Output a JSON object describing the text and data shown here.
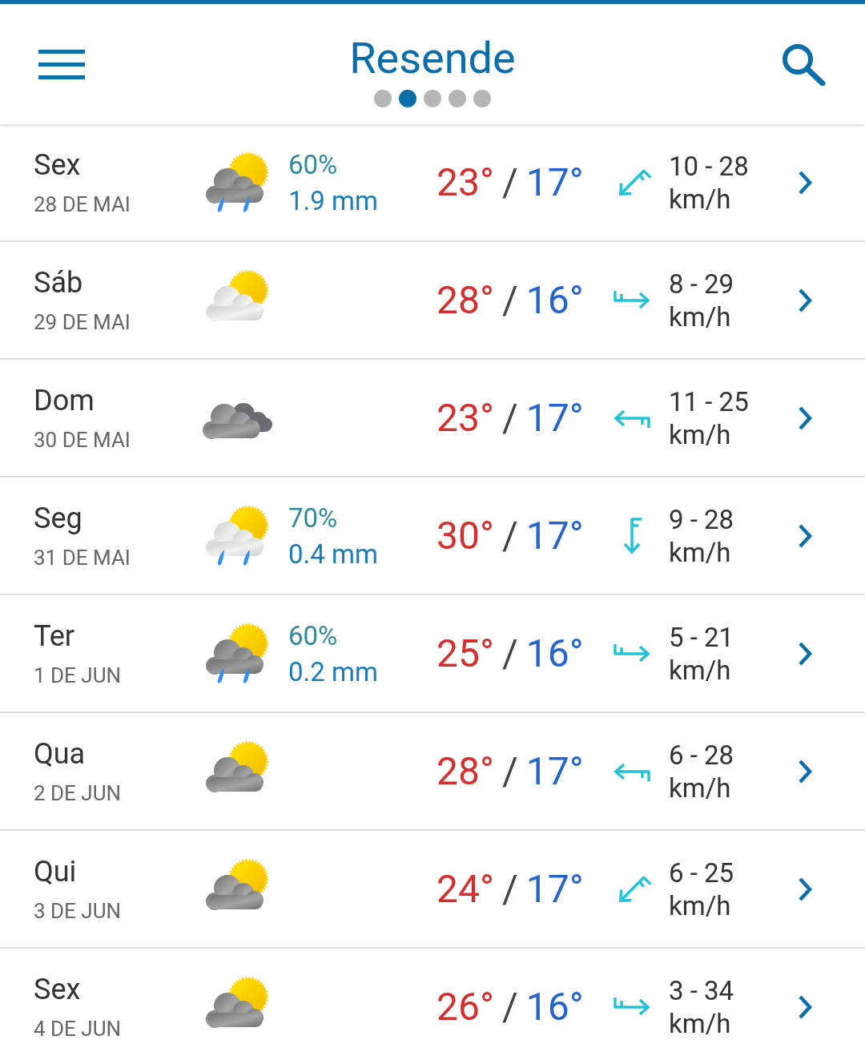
{
  "header": {
    "title": "Resende",
    "pages": [
      {
        "selected": false
      },
      {
        "selected": true
      },
      {
        "selected": false
      },
      {
        "selected": false
      },
      {
        "selected": false
      }
    ]
  },
  "days": [
    {
      "day": "Sex",
      "date": "28 DE MAI",
      "weather_icon": {
        "kind": "rain_sun_dark"
      },
      "chance": "60%",
      "amount": "1.9 mm",
      "max": "23°",
      "separator": "/",
      "min": "17°",
      "wind_arrow": {
        "kind": "southwest"
      },
      "wind": "10 - 28",
      "unit": "km/h"
    },
    {
      "day": "Sáb",
      "date": "29 DE MAI",
      "weather_icon": {
        "kind": "sun_light_cloud"
      },
      "max": "28°",
      "separator": "/",
      "min": "16°",
      "wind_arrow": {
        "kind": "east"
      },
      "wind": "8 - 29",
      "unit": "km/h"
    },
    {
      "day": "Dom",
      "date": "30 DE MAI",
      "weather_icon": {
        "kind": "overcast"
      },
      "max": "23°",
      "separator": "/",
      "min": "17°",
      "wind_arrow": {
        "kind": "west"
      },
      "wind": "11 - 25",
      "unit": "km/h"
    },
    {
      "day": "Seg",
      "date": "31 DE MAI",
      "weather_icon": {
        "kind": "rain_sun_light"
      },
      "chance": "70%",
      "amount": "0.4 mm",
      "max": "30°",
      "separator": "/",
      "min": "17°",
      "wind_arrow": {
        "kind": "south"
      },
      "wind": "9 - 28",
      "unit": "km/h"
    },
    {
      "day": "Ter",
      "date": "1 DE JUN",
      "weather_icon": {
        "kind": "rain_sun_dark"
      },
      "chance": "60%",
      "amount": "0.2 mm",
      "max": "25°",
      "separator": "/",
      "min": "16°",
      "wind_arrow": {
        "kind": "east"
      },
      "wind": "5 - 21",
      "unit": "km/h"
    },
    {
      "day": "Qua",
      "date": "2 DE JUN",
      "weather_icon": {
        "kind": "sun_dark_cloud"
      },
      "max": "28°",
      "separator": "/",
      "min": "17°",
      "wind_arrow": {
        "kind": "west"
      },
      "wind": "6 - 28",
      "unit": "km/h"
    },
    {
      "day": "Qui",
      "date": "3 DE JUN",
      "weather_icon": {
        "kind": "sun_dark_cloud"
      },
      "max": "24°",
      "separator": "/",
      "min": "17°",
      "wind_arrow": {
        "kind": "southwest"
      },
      "wind": "6 - 25",
      "unit": "km/h"
    },
    {
      "day": "Sex",
      "date": "4 DE JUN",
      "weather_icon": {
        "kind": "sun_dark_cloud"
      },
      "max": "26°",
      "separator": "/",
      "min": "16°",
      "wind_arrow": {
        "kind": "east"
      },
      "wind": "3 - 34",
      "unit": "km/h"
    }
  ]
}
